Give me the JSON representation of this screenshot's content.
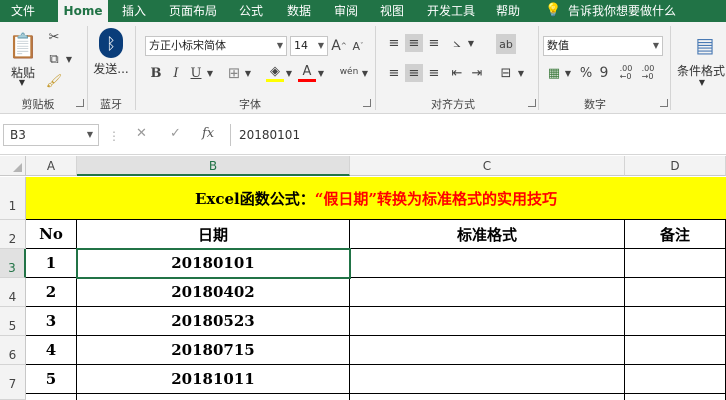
{
  "tabs": [
    "文件",
    "Home",
    "插入",
    "页面布局",
    "公式",
    "数据",
    "审阅",
    "视图",
    "开发工具",
    "帮助"
  ],
  "tell_me": "告诉我你想要做什么",
  "ribbon": {
    "clipboard": {
      "paste": "粘贴",
      "label": "剪贴板"
    },
    "bluetooth": {
      "send": "发送...",
      "label": "蓝牙"
    },
    "font": {
      "name": "方正小标宋简体",
      "size": "14",
      "label": "字体",
      "bold": "B",
      "italic": "I",
      "underline": "U",
      "grow": "A",
      "shrink": "A",
      "font_color_glyph": "A",
      "phonetic_glyph": "wén"
    },
    "alignment": {
      "label": "对齐方式"
    },
    "number": {
      "format": "数值",
      "label": "数字",
      "percent": "%",
      "comma": "9"
    },
    "styles": {
      "conditional": "条件格式"
    }
  },
  "formula_bar": {
    "name_box": "B3",
    "fx": "fx",
    "value": "20180101"
  },
  "columns": [
    "A",
    "B",
    "C",
    "D"
  ],
  "rows": [
    "1",
    "2",
    "3",
    "4",
    "5",
    "6",
    "7"
  ],
  "title": {
    "part1": "Excel函数公式：",
    "part2": "“假日期”转换为标准格式的实用技巧"
  },
  "headers": [
    "No",
    "日期",
    "标准格式",
    "备注"
  ],
  "data": [
    [
      "1",
      "20180101"
    ],
    [
      "2",
      "20180402"
    ],
    [
      "3",
      "20180523"
    ],
    [
      "4",
      "20180715"
    ],
    [
      "5",
      "20181011"
    ]
  ]
}
